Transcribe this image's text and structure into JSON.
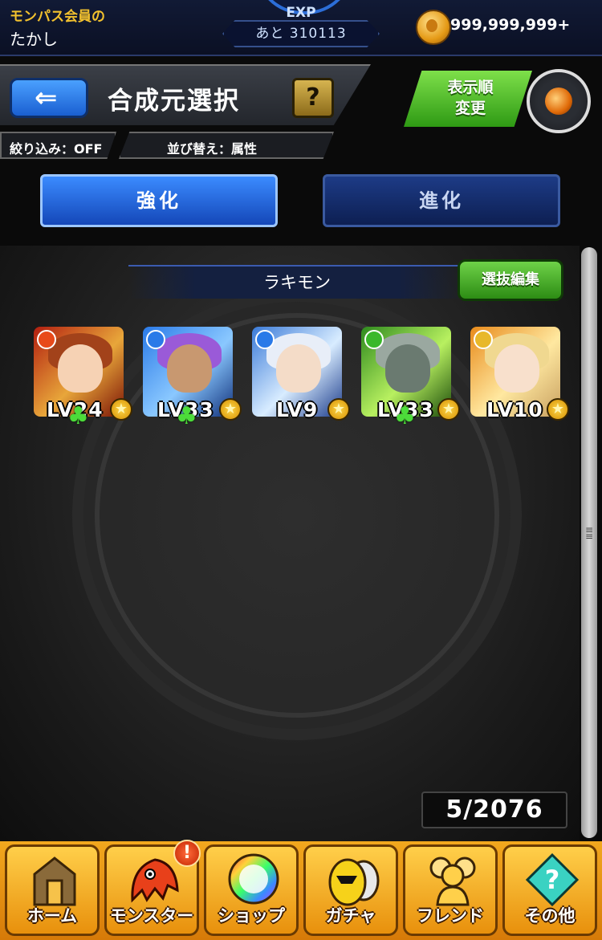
{
  "status": {
    "member_label": "モンパス会員の",
    "username": "たかし",
    "exp_label": "EXP",
    "exp_remaining": "あと 310113",
    "coins": "999,999,999+"
  },
  "header": {
    "back_glyph": "⇐",
    "title": "合成元選択",
    "help_glyph": "?",
    "filter": "絞り込み：OFF",
    "sort": "並び替え：属性",
    "order_button": "表示順\n変更"
  },
  "tabs": [
    {
      "label": "強化",
      "active": true
    },
    {
      "label": "進化",
      "active": false
    }
  ],
  "group": {
    "name": "ラキモン",
    "edit_button": "選抜編集"
  },
  "monsters": [
    {
      "level": "LV24",
      "clover": true,
      "attr": "fire-icon",
      "attr_color": "#e84a1a"
    },
    {
      "level": "LV33",
      "clover": true,
      "attr": "water-icon",
      "attr_color": "#2a7ae8"
    },
    {
      "level": "LV9",
      "clover": false,
      "attr": "water-icon",
      "attr_color": "#2a7ae8"
    },
    {
      "level": "LV33",
      "clover": true,
      "attr": "wood-icon",
      "attr_color": "#3ab82a"
    },
    {
      "level": "LV10",
      "clover": false,
      "attr": "light-icon",
      "attr_color": "#e8b82a"
    }
  ],
  "count": "5/2076",
  "nav": [
    {
      "label": "ホーム",
      "icon": "home-icon"
    },
    {
      "label": "モンスター",
      "icon": "monster-icon",
      "alert": "!"
    },
    {
      "label": "ショップ",
      "icon": "orb-icon"
    },
    {
      "label": "ガチャ",
      "icon": "egg-icon"
    },
    {
      "label": "フレンド",
      "icon": "friends-icon"
    },
    {
      "label": "その他",
      "icon": "other-icon"
    }
  ]
}
